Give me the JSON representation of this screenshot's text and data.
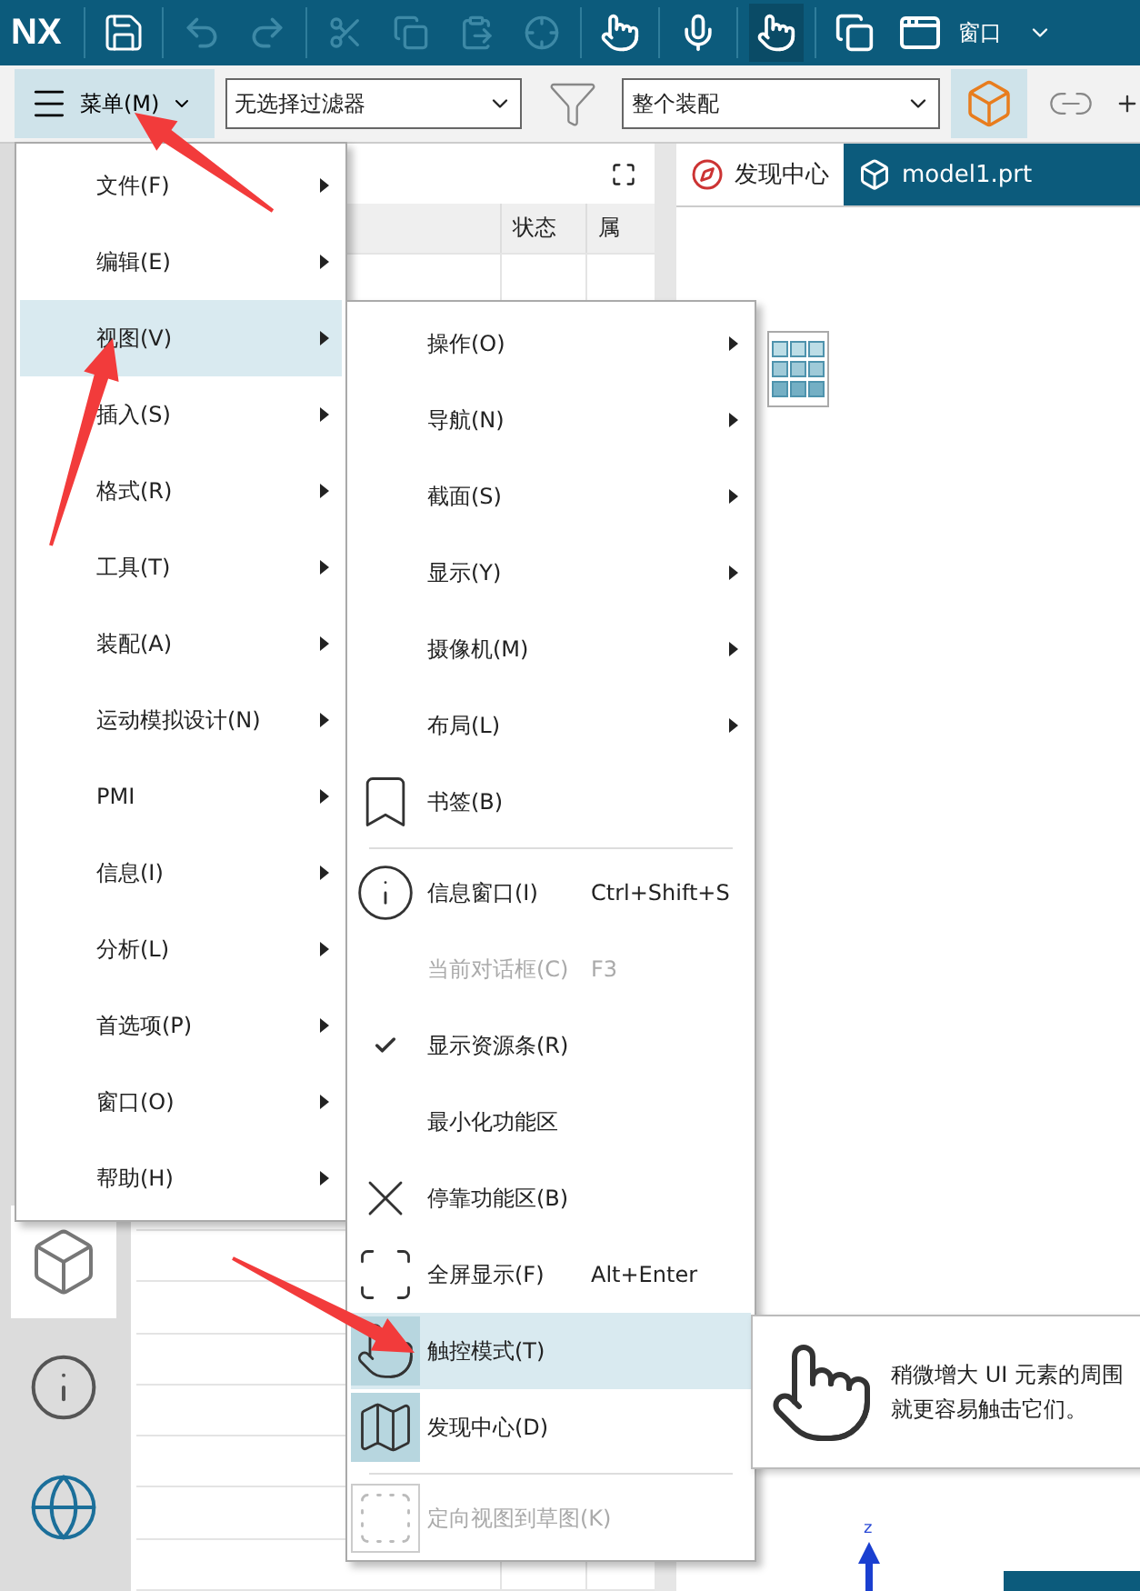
{
  "top_bar": {
    "logo": "NX",
    "window_menu": "窗口"
  },
  "toolbar": {
    "menu_button": "菜单(M)",
    "filter": "无选择过滤器",
    "scope": "整个装配"
  },
  "navigator": {
    "columns": [
      "状态",
      "属"
    ]
  },
  "tabs": [
    {
      "label": "发现中心",
      "selected": false
    },
    {
      "label": "model1.prt",
      "selected": true
    }
  ],
  "main_menu": {
    "items": [
      {
        "label": "文件(F)",
        "selected": false
      },
      {
        "label": "编辑(E)",
        "selected": false
      },
      {
        "label": "视图(V)",
        "selected": true
      },
      {
        "label": "插入(S)",
        "selected": false
      },
      {
        "label": "格式(R)",
        "selected": false
      },
      {
        "label": "工具(T)",
        "selected": false
      },
      {
        "label": "装配(A)",
        "selected": false
      },
      {
        "label": "运动模拟设计(N)",
        "selected": false
      },
      {
        "label": "PMI",
        "selected": false
      },
      {
        "label": "信息(I)",
        "selected": false
      },
      {
        "label": "分析(L)",
        "selected": false
      },
      {
        "label": "首选项(P)",
        "selected": false
      },
      {
        "label": "窗口(O)",
        "selected": false
      },
      {
        "label": "帮助(H)",
        "selected": false
      }
    ]
  },
  "sub_menu": {
    "items": [
      {
        "kind": "submenu",
        "label": "操作(O)",
        "selected": false,
        "disabled": false,
        "checked": false
      },
      {
        "kind": "submenu",
        "label": "导航(N)",
        "selected": false,
        "disabled": false,
        "checked": false
      },
      {
        "kind": "submenu",
        "label": "截面(S)",
        "selected": false,
        "disabled": false,
        "checked": false
      },
      {
        "kind": "submenu",
        "label": "显示(Y)",
        "selected": false,
        "disabled": false,
        "checked": false
      },
      {
        "kind": "submenu",
        "label": "摄像机(M)",
        "selected": false,
        "disabled": false,
        "checked": false
      },
      {
        "kind": "submenu",
        "label": "布局(L)",
        "selected": false,
        "disabled": false,
        "checked": false
      },
      {
        "kind": "command",
        "label": "书签(B)",
        "selected": false,
        "disabled": false,
        "checked": false
      },
      {
        "kind": "separator"
      },
      {
        "kind": "command",
        "label": "信息窗口(I)",
        "shortcut": "Ctrl+Shift+S",
        "selected": false,
        "disabled": false,
        "checked": false
      },
      {
        "kind": "command",
        "label": "当前对话框(C)",
        "shortcut": "F3",
        "selected": false,
        "disabled": true,
        "checked": false
      },
      {
        "kind": "command",
        "label": "显示资源条(R)",
        "selected": false,
        "disabled": false,
        "checked": true
      },
      {
        "kind": "command",
        "label": "最小化功能区",
        "selected": false,
        "disabled": false,
        "checked": false
      },
      {
        "kind": "command",
        "label": "停靠功能区(B)",
        "selected": false,
        "disabled": false,
        "checked": false
      },
      {
        "kind": "command",
        "label": "全屏显示(F)",
        "shortcut": "Alt+Enter",
        "selected": false,
        "disabled": false,
        "checked": false
      },
      {
        "kind": "command",
        "label": "触控模式(T)",
        "selected": true,
        "disabled": false,
        "checked": false
      },
      {
        "kind": "command",
        "label": "发现中心(D)",
        "selected": false,
        "disabled": false,
        "checked": false
      },
      {
        "kind": "separator"
      },
      {
        "kind": "command",
        "label": "定向视图到草图(K)",
        "selected": false,
        "disabled": true,
        "checked": false
      }
    ]
  },
  "tooltip": {
    "lines": [
      "稍微增大 UI 元素的周围",
      "就更容易触击它们。"
    ]
  },
  "canvas": {
    "axis_label": "z"
  }
}
